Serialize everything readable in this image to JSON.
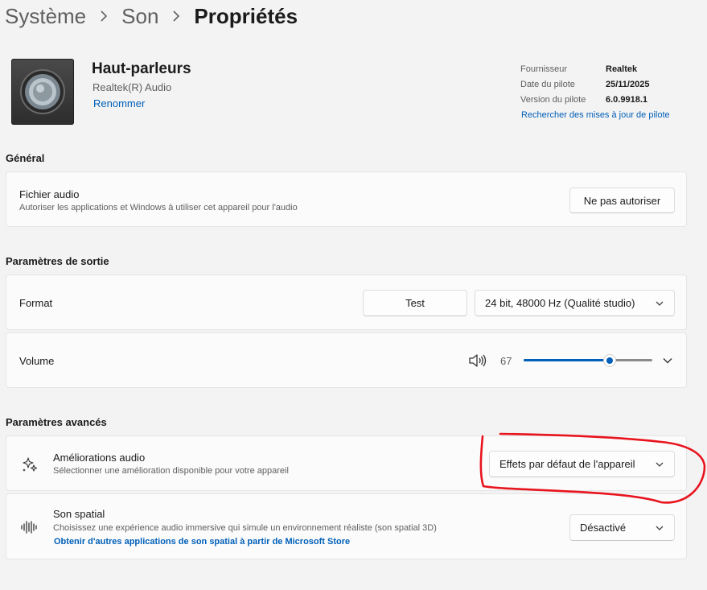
{
  "breadcrumb": {
    "items": [
      "Système",
      "Son",
      "Propriétés"
    ]
  },
  "device": {
    "name": "Haut-parleurs",
    "subtitle": "Realtek(R) Audio",
    "rename_link": "Renommer"
  },
  "driver": {
    "provider_label": "Fournisseur",
    "provider_value": "Realtek",
    "date_label": "Date du pilote",
    "date_value": "25/11/2025",
    "version_label": "Version du pilote",
    "version_value": "6.0.9918.1",
    "update_link": "Rechercher des mises à jour de pilote"
  },
  "general": {
    "title": "Général",
    "audio_file": {
      "title": "Fichier audio",
      "desc": "Autoriser les applications et Windows à utiliser cet appareil pour l'audio",
      "button": "Ne pas autoriser"
    }
  },
  "output": {
    "title": "Paramètres de sortie",
    "format": {
      "label": "Format",
      "test_button": "Test",
      "selected": "24 bit, 48000 Hz (Qualité studio)"
    },
    "volume": {
      "label": "Volume",
      "value": 67
    }
  },
  "advanced": {
    "title": "Paramètres avancés",
    "enhancements": {
      "title": "Améliorations audio",
      "desc": "Sélectionner une amélioration disponible pour votre appareil",
      "selected": "Effets par défaut de l'appareil"
    },
    "spatial": {
      "title": "Son spatial",
      "desc": "Choisissez une expérience audio immersive qui simule un environnement réaliste (son spatial 3D)",
      "store_link": "Obtenir d'autres applications de son spatial à partir de Microsoft Store",
      "selected": "Désactivé"
    }
  },
  "colors": {
    "accent": "#005fb8",
    "annotation": "#e8141e"
  },
  "icons": [
    "chevron-right-icon",
    "speaker-device-icon",
    "chevron-down-icon",
    "volume-icon",
    "sparkle-icon",
    "spatial-sound-icon"
  ]
}
